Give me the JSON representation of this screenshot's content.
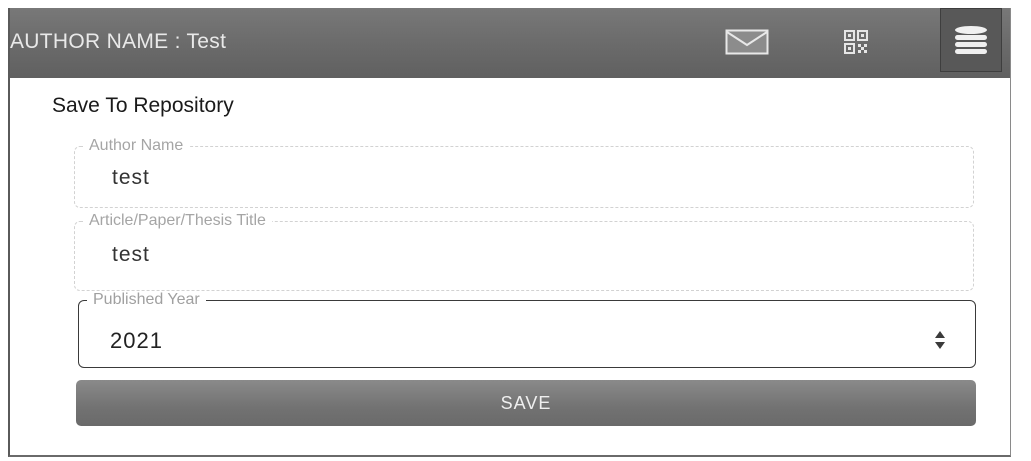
{
  "header": {
    "author_label": "AUTHOR NAME : Test",
    "icons": [
      "mail-icon",
      "qr-code-icon",
      "database-icon"
    ]
  },
  "form": {
    "title": "Save To Repository",
    "author_name": {
      "label": "Author Name",
      "value": "test"
    },
    "paper_title": {
      "label": "Article/Paper/Thesis Title",
      "value": "test"
    },
    "published_year": {
      "label": "Published Year",
      "value": "2021"
    },
    "save_label": "SAVE"
  }
}
